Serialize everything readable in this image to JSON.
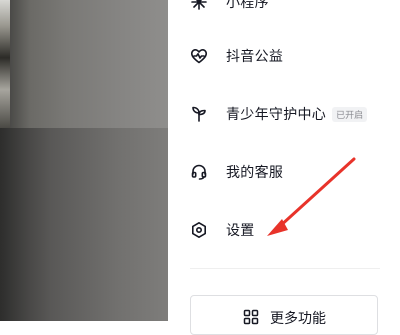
{
  "menu": {
    "items": [
      {
        "label": "小程序",
        "icon": "mini-program-icon"
      },
      {
        "label": "抖音公益",
        "icon": "heart-pulse-icon"
      },
      {
        "label": "青少年守护中心",
        "icon": "sprout-icon",
        "badge": "已开启"
      },
      {
        "label": "我的客服",
        "icon": "headset-icon"
      },
      {
        "label": "设置",
        "icon": "hexagon-settings-icon"
      }
    ],
    "more_label": "更多功能",
    "more_icon": "grid-apps-icon"
  },
  "colors": {
    "text": "#161823",
    "badge_text": "#8a8b91",
    "badge_bg": "#f1f2f4",
    "annotation_arrow": "#e8332a"
  }
}
